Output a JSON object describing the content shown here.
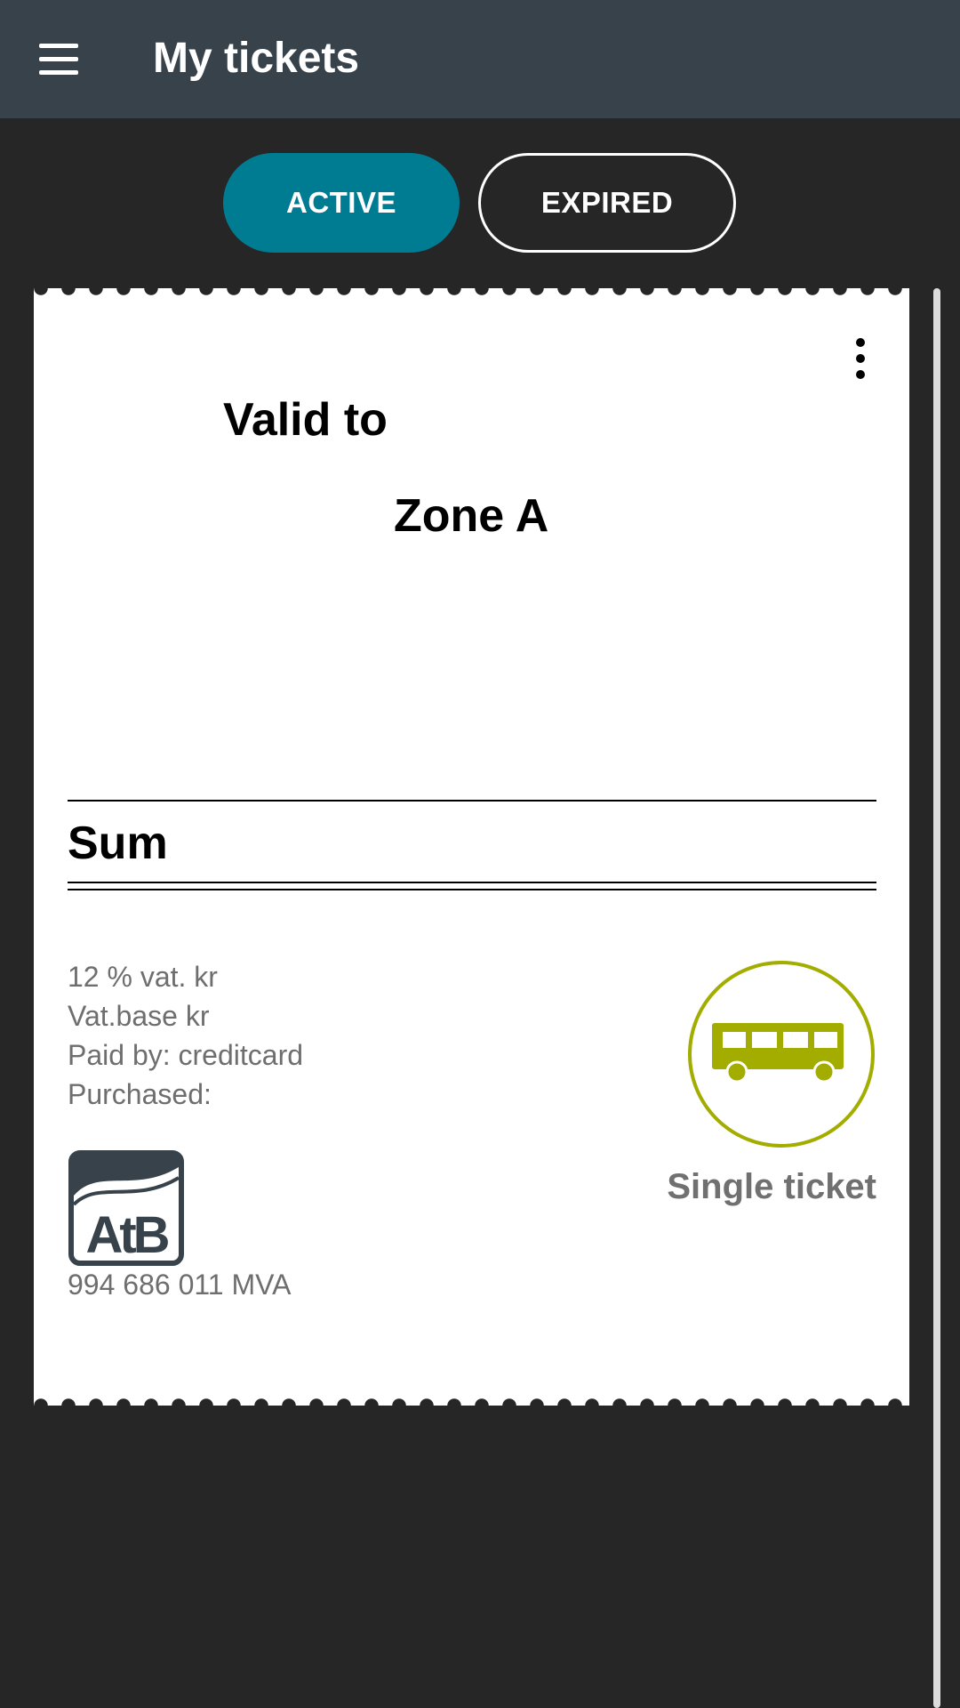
{
  "app_bar": {
    "title": "My tickets",
    "menu_icon": "hamburger-menu-icon"
  },
  "tabs": [
    {
      "label": "ACTIVE",
      "selected": true
    },
    {
      "label": "EXPIRED",
      "selected": false
    }
  ],
  "ticket": {
    "menu_icon": "more-vertical-icon",
    "valid_to_label": "Valid to",
    "zone": "Zone A",
    "sum_label": "Sum",
    "details": {
      "vat": "12 % vat. kr",
      "vat_base": "Vat.base kr",
      "paid_by": "Paid by: creditcard",
      "purchased": "Purchased:"
    },
    "logo_text": "AtB",
    "org_number": "994 686 011 MVA",
    "type_icon": "bus-icon",
    "type_label": "Single ticket"
  },
  "colors": {
    "app_bar": "#37424a",
    "background": "#262626",
    "active_tab": "#007c92",
    "bus_accent": "#a2ad00",
    "logo": "#37424a",
    "muted_text": "#6e6e6e"
  }
}
